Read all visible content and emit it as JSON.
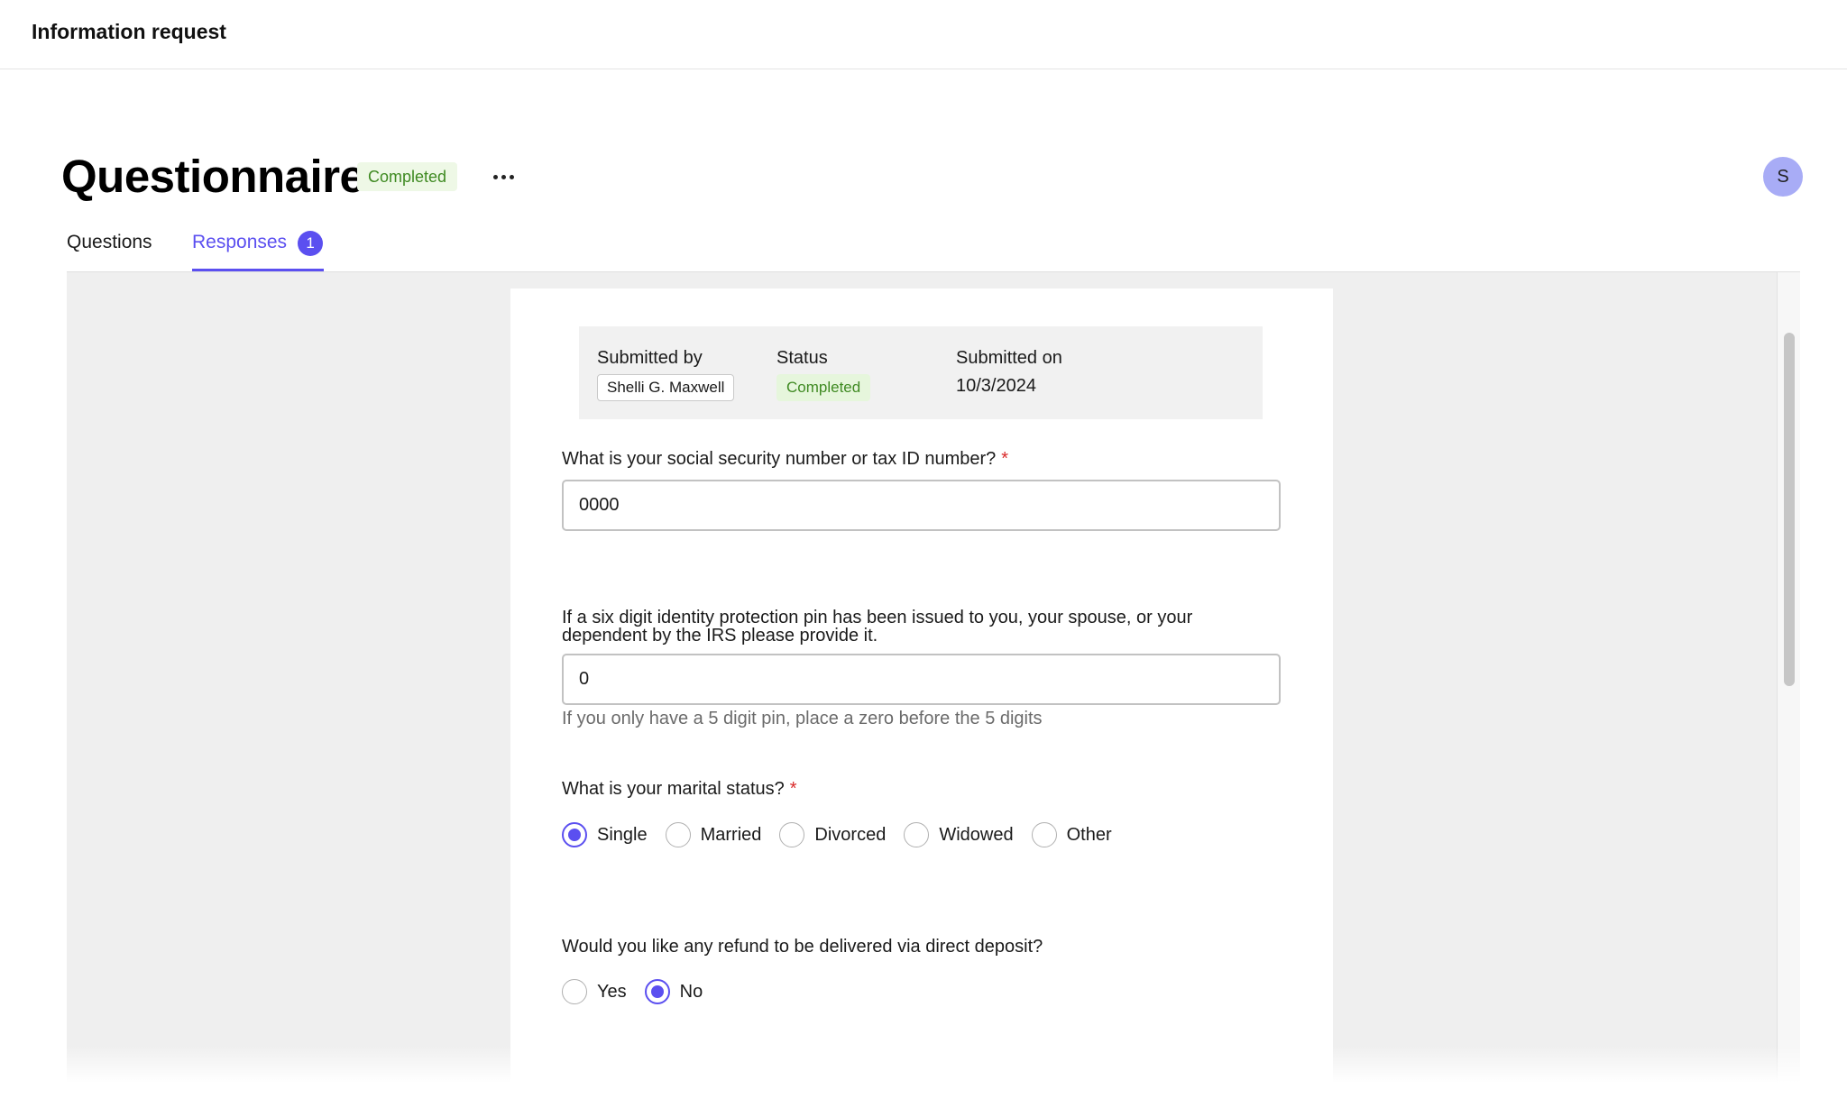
{
  "app": {
    "title": "Information request"
  },
  "page": {
    "title": "Questionnaire",
    "status_badge": "Completed",
    "avatar_initial": "S"
  },
  "tabs": [
    {
      "label": "Questions",
      "active": false
    },
    {
      "label": "Responses",
      "active": true,
      "count": "1"
    }
  ],
  "summary": {
    "submitted_by_label": "Submitted by",
    "submitted_by_value": "Shelli G. Maxwell",
    "status_label": "Status",
    "status_value": "Completed",
    "submitted_on_label": "Submitted on",
    "submitted_on_value": "10/3/2024"
  },
  "questions": {
    "ssn": {
      "label": "What is your social security number or tax ID number?",
      "required_mark": "*",
      "value": "0000"
    },
    "pin": {
      "label": "If a six digit identity protection pin has been issued to you, your spouse, or your dependent by the IRS please provide it.",
      "value": "0",
      "hint": "If you only have a 5 digit pin, place a zero before the 5 digits"
    },
    "marital": {
      "label": "What is your marital status?",
      "required_mark": "*",
      "options": [
        "Single",
        "Married",
        "Divorced",
        "Widowed",
        "Other"
      ],
      "selected": "Single"
    },
    "deposit": {
      "label": "Would you like any refund to be delivered via direct deposit?",
      "options": [
        "Yes",
        "No"
      ],
      "selected": "No"
    }
  },
  "colors": {
    "accent": "#5b4ff0",
    "status_green": "#3f8a22",
    "required_red": "#d92a2a"
  }
}
